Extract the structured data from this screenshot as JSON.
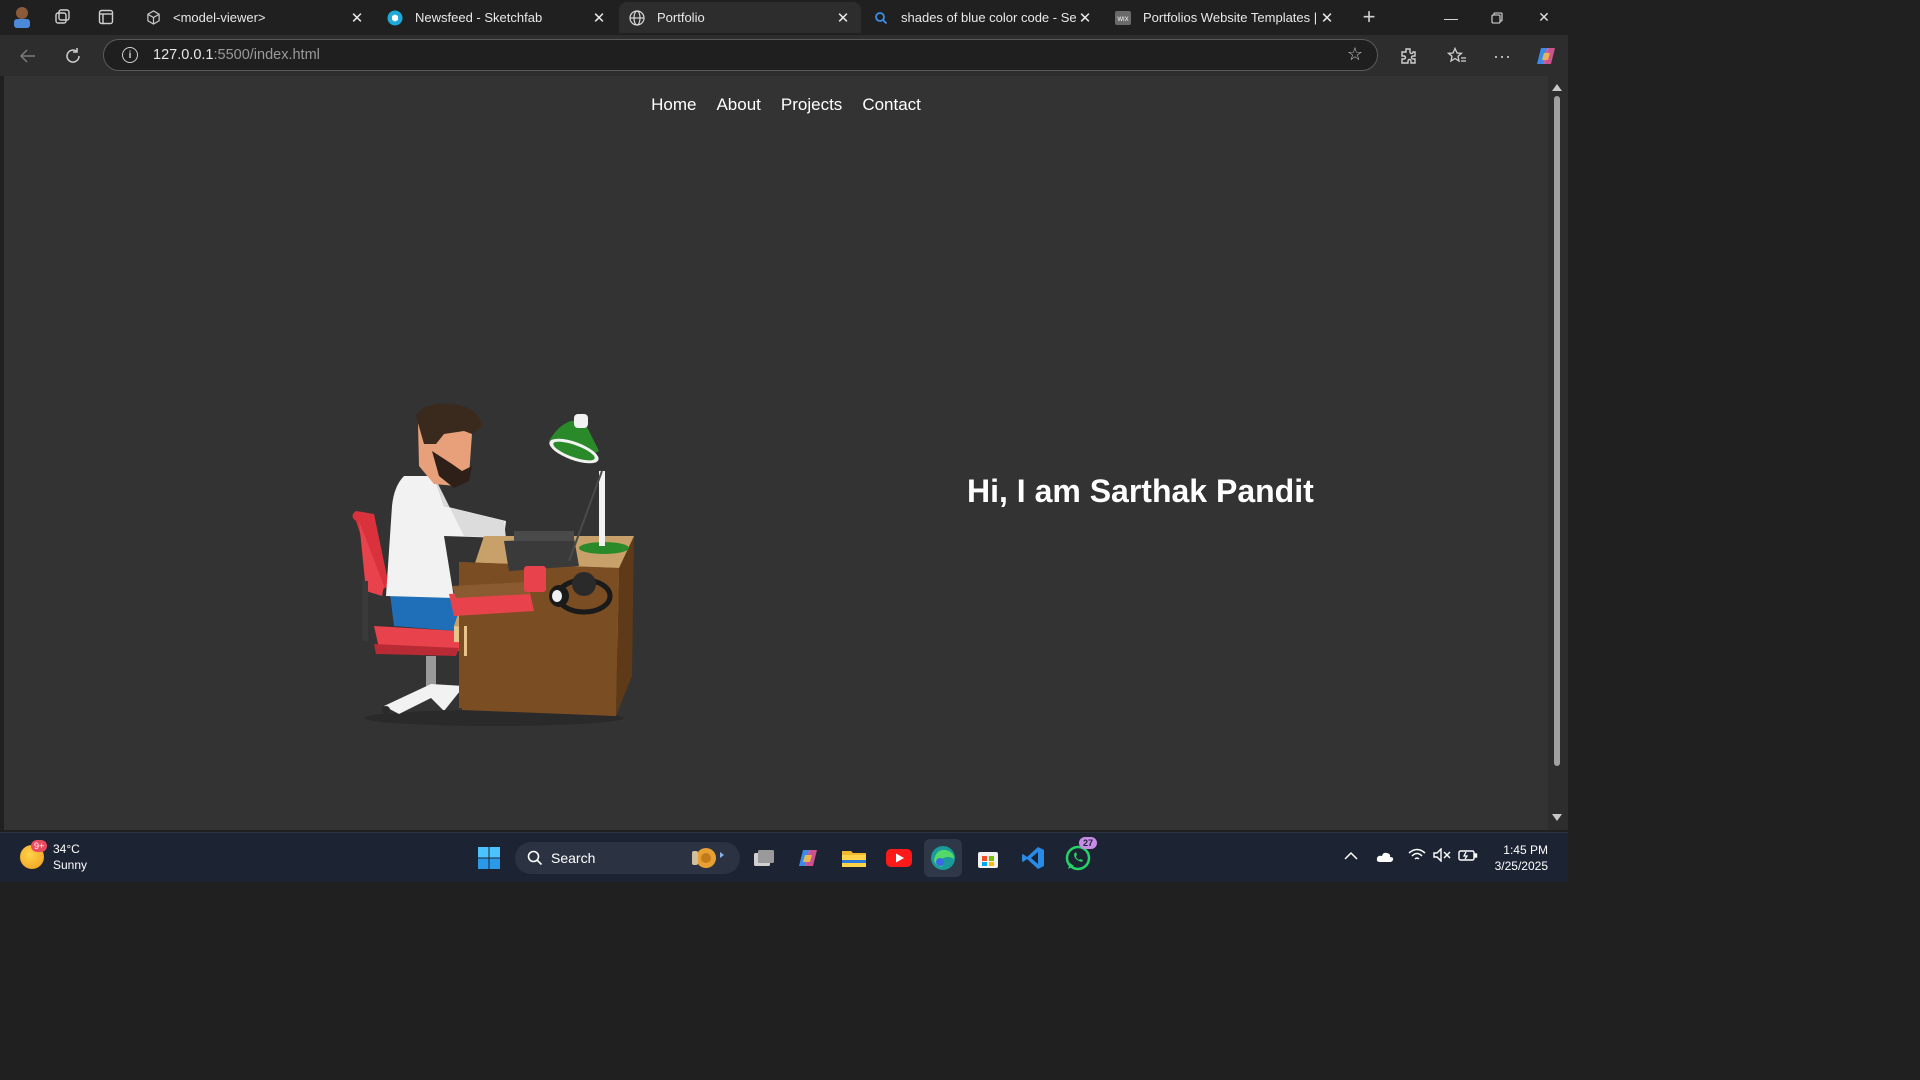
{
  "browser": {
    "tabs": [
      {
        "title": "<model-viewer>",
        "favicon": "cube-icon",
        "active": false
      },
      {
        "title": "Newsfeed - Sketchfab",
        "favicon": "sketchfab-icon",
        "active": false
      },
      {
        "title": "Portfolio",
        "favicon": "globe-icon",
        "active": true
      },
      {
        "title": "shades of blue color code - Searc",
        "favicon": "search-icon",
        "active": false
      },
      {
        "title": "Portfolios Website Templates | Po",
        "favicon": "wix-icon",
        "active": false
      }
    ],
    "url_host": "127.0.0.1",
    "url_rest": ":5500/index.html"
  },
  "page": {
    "nav": [
      "Home",
      "About",
      "Projects",
      "Contact"
    ],
    "hero_title": "Hi, I am Sarthak Pandit",
    "background": "#333333"
  },
  "taskbar": {
    "weather_temp": "34°C",
    "weather_desc": "Sunny",
    "weather_badge": "9+",
    "search_label": "Search",
    "whatsapp_badge": "27",
    "time": "1:45 PM",
    "date": "3/25/2025"
  }
}
